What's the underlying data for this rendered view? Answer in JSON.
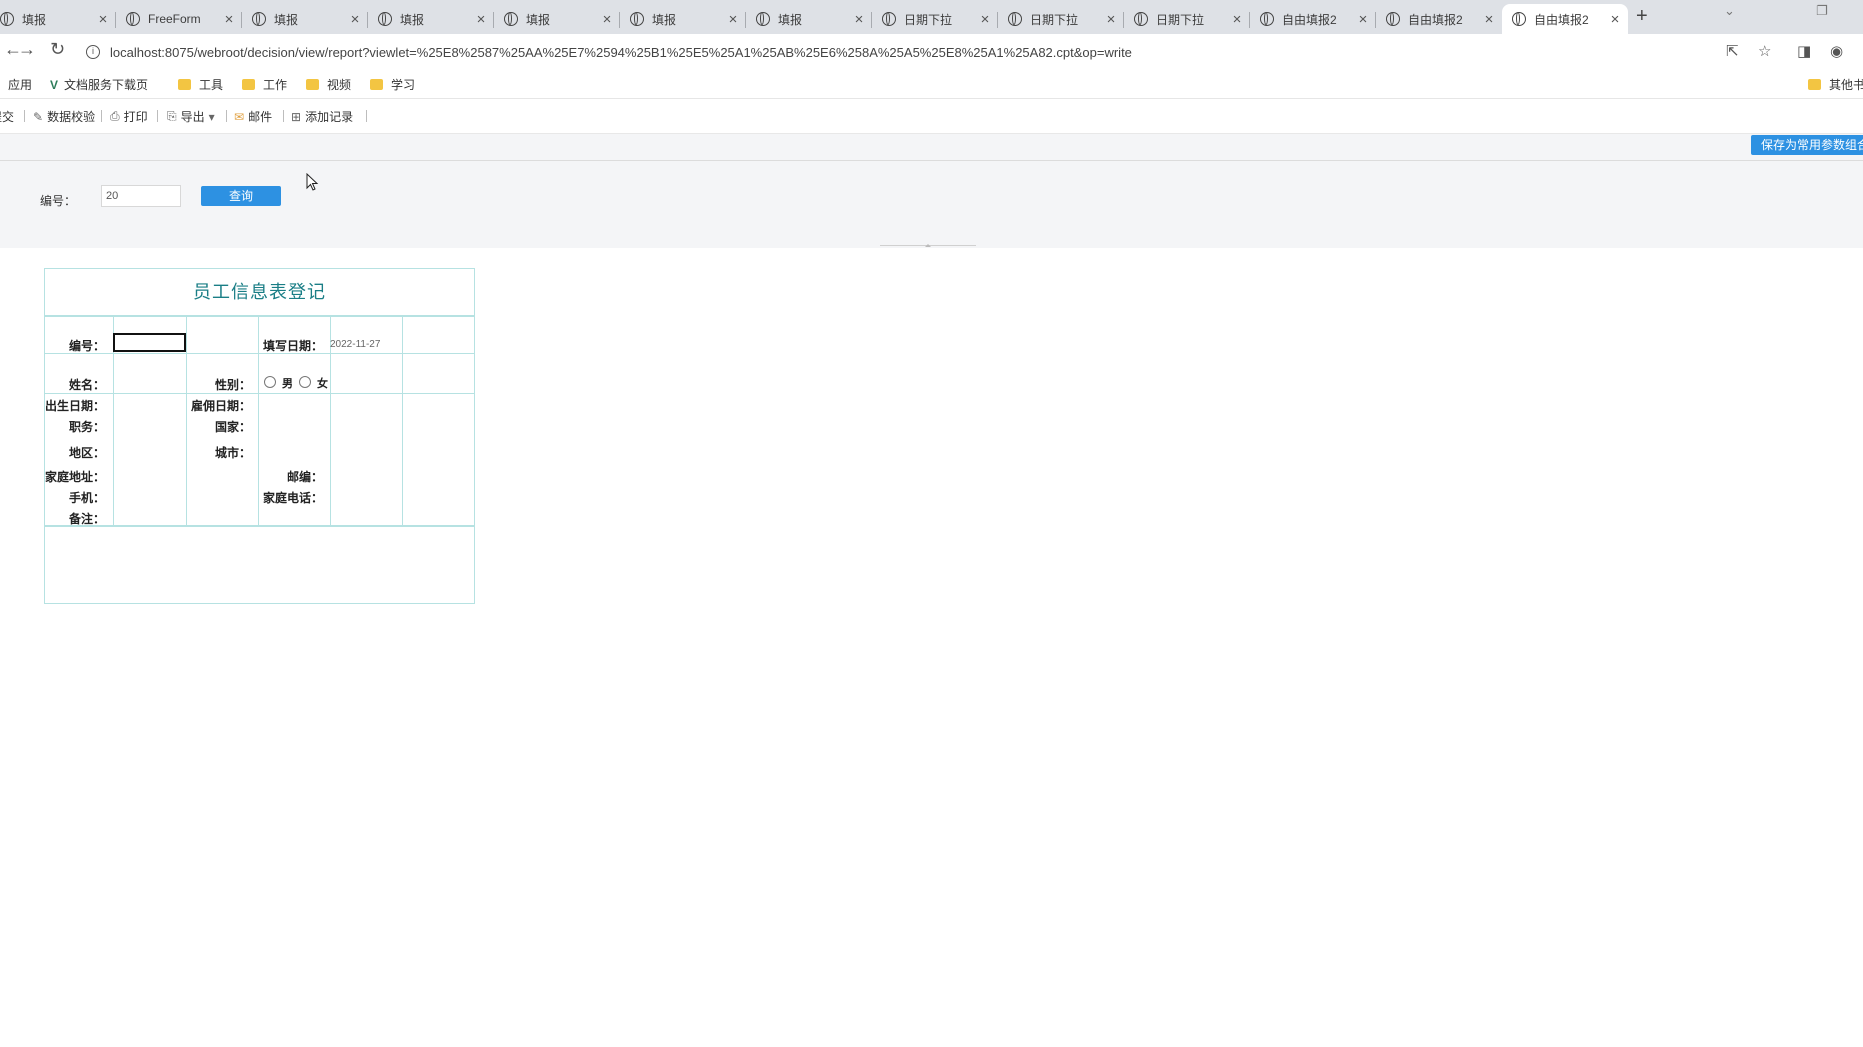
{
  "browser": {
    "tabs": [
      {
        "label": "填报"
      },
      {
        "label": "FreeForm"
      },
      {
        "label": "填报"
      },
      {
        "label": "填报"
      },
      {
        "label": "填报"
      },
      {
        "label": "填报"
      },
      {
        "label": "填报"
      },
      {
        "label": "日期下拉"
      },
      {
        "label": "日期下拉"
      },
      {
        "label": "日期下拉"
      },
      {
        "label": "自由填报2"
      },
      {
        "label": "自由填报2"
      },
      {
        "label": "自由填报2"
      }
    ],
    "url": "localhost:8075/webroot/decision/view/report?viewlet=%25E8%2587%25AA%25E7%2594%25B1%25E5%25A1%25AB%25E6%258A%25A5%25E8%25A1%25A82.cpt&op=write",
    "bookmarks": [
      {
        "label": "应用",
        "icon": "apps-icon"
      },
      {
        "label": "文档服务下载页",
        "icon": "v-logo-icon"
      },
      {
        "label": "工具",
        "icon": "folder-icon"
      },
      {
        "label": "工作",
        "icon": "folder-icon"
      },
      {
        "label": "视频",
        "icon": "folder-icon"
      },
      {
        "label": "学习",
        "icon": "folder-icon"
      }
    ],
    "bookmarks_right": "其他书签"
  },
  "toolbar": {
    "items": [
      {
        "label": "提交",
        "icon": "submit-icon"
      },
      {
        "label": "数据校验",
        "icon": "check-icon"
      },
      {
        "label": "打印",
        "icon": "print-icon"
      },
      {
        "label": "导出",
        "icon": "export-icon"
      },
      {
        "label": "邮件",
        "icon": "mail-icon"
      },
      {
        "label": "添加记录",
        "icon": "add-record-icon"
      }
    ],
    "save_button": "保存为常用参数组合"
  },
  "params": {
    "label": "编号：",
    "value": "20",
    "query_button": "查询"
  },
  "report": {
    "title": "员工信息表登记",
    "fields": {
      "id": "编号：",
      "fill_date": "填写日期：",
      "fill_date_value": "2022-11-27",
      "name": "姓名：",
      "gender": "性别：",
      "gender_options": [
        "男",
        "女"
      ],
      "birth_date": "出生日期：",
      "hire_date": "雇佣日期：",
      "title": "职务：",
      "country": "国家：",
      "region": "地区：",
      "city": "城市：",
      "home_address": "家庭地址：",
      "postcode": "邮编：",
      "mobile": "手机：",
      "home_phone": "家庭电话：",
      "remarks": "备注："
    }
  }
}
